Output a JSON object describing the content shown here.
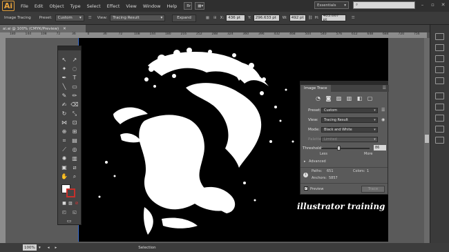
{
  "menu": {
    "logo": "Ai",
    "items": [
      "File",
      "Edit",
      "Object",
      "Type",
      "Select",
      "Effect",
      "View",
      "Window",
      "Help"
    ],
    "workspace": "Essentials"
  },
  "control_bar": {
    "mode_label": "Image Tracing",
    "preset_label": "Preset:",
    "preset_value": "Custom",
    "view_label": "View:",
    "view_value": "Tracing Result",
    "expand_label": "Expand",
    "x_label": "X:",
    "x_value": "436 pt",
    "y_label": "Y:",
    "y_value": "296.633 pt",
    "w_label": "W:",
    "w_value": "492 pt",
    "h_label": "H:",
    "h_value": "403.667 pt"
  },
  "document": {
    "tab_title": "ai.ai @ 100% (CMYK/Preview)"
  },
  "ruler": {
    "h_ticks": [
      "180",
      "144",
      "108",
      "72",
      "36",
      "0",
      "36",
      "72",
      "108",
      "144",
      "180",
      "216",
      "252",
      "288",
      "324",
      "360",
      "396",
      "432",
      "468",
      "504",
      "540",
      "576",
      "612",
      "648",
      "684",
      "720",
      "756"
    ]
  },
  "status": {
    "zoom": "100%",
    "tool": "Selection"
  },
  "image_trace": {
    "title": "Image Trace",
    "preset_label": "Preset:",
    "preset_value": "Custom",
    "view_label": "View:",
    "view_value": "Tracing Result",
    "mode_label": "Mode:",
    "mode_value": "Black and White",
    "palette_label": "Palette:",
    "palette_value": "Limited",
    "threshold_label": "Threshold:",
    "threshold_value": "86",
    "less_label": "Less",
    "more_label": "More",
    "advanced_label": "Advanced",
    "paths_label": "Paths:",
    "paths_value": "651",
    "colors_label": "Colors:",
    "colors_value": "1",
    "anchors_label": "Anchors:",
    "anchors_value": "5857",
    "preview_label": "Preview",
    "trace_button": "Trace"
  },
  "artwork": {
    "watermark": "illustrator training"
  }
}
